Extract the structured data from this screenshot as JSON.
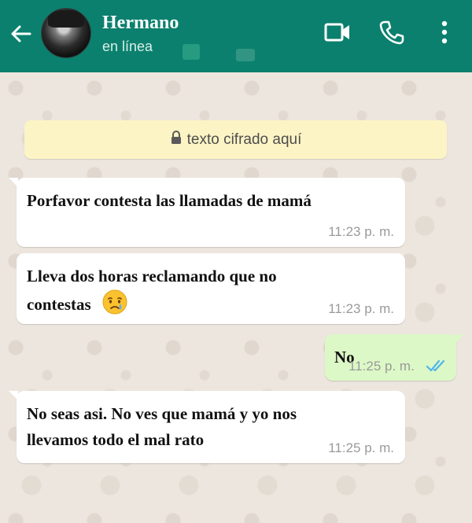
{
  "header": {
    "contact_name": "Hermano",
    "status": "en línea",
    "bg_color": "#0b806e"
  },
  "icons": {
    "back": "arrow-left",
    "video": "video-camera",
    "call": "phone",
    "menu": "more-vertical"
  },
  "banner": {
    "text": "texto cifrado aquí",
    "icon": "lock"
  },
  "messages": [
    {
      "direction": "incoming",
      "text": "Porfavor contesta las llamadas de mamá",
      "time": "11:23 p. m."
    },
    {
      "direction": "incoming",
      "line1": "Lleva dos horas reclamando que no",
      "line2": "contestas",
      "emoji": "crying-face",
      "time": "11:23 p. m."
    },
    {
      "direction": "outgoing",
      "text": "No",
      "time": "11:25 p. m.",
      "read": true,
      "tick_color": "#4fb6ec"
    },
    {
      "direction": "incoming",
      "line1": "No seas asi. No ves que mamá y yo nos",
      "line2": "llevamos todo el mal rato",
      "time": "11:25 p. m."
    }
  ]
}
